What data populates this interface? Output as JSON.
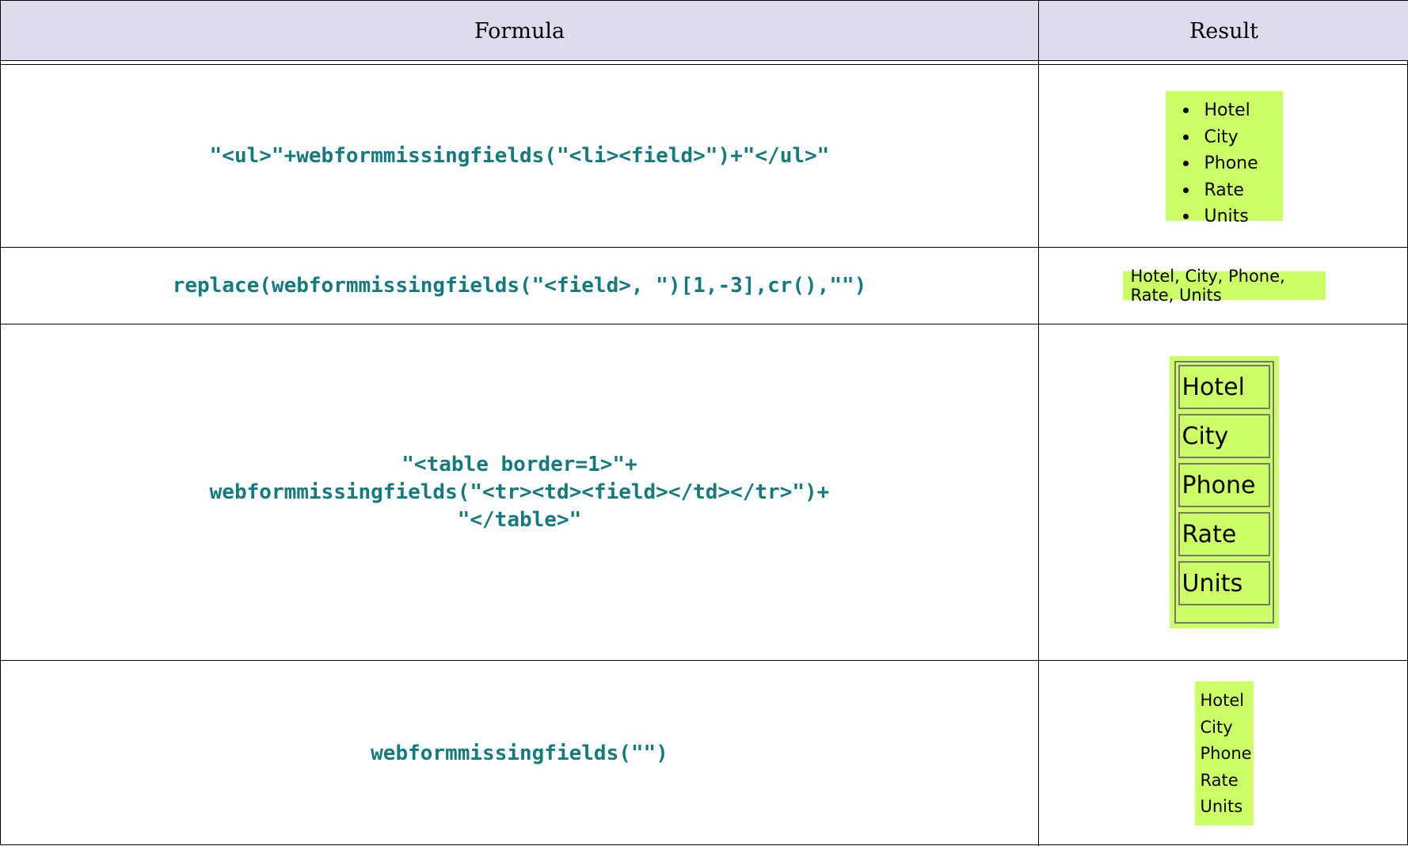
{
  "header": {
    "formula_label": "Formula",
    "result_label": "Result"
  },
  "rows": [
    {
      "formula": "\"<ul>\"+webformmissingfields(\"<li><field>\")+\"</ul>\"",
      "result": {
        "kind": "bulleted-list",
        "items": [
          "Hotel",
          "City",
          "Phone",
          "Rate",
          "Units"
        ]
      }
    },
    {
      "formula": "replace(webformmissingfields(\"<field>, \")[1,-3],cr(),\"\")",
      "result": {
        "kind": "comma-list",
        "text": "Hotel, City, Phone, Rate, Units"
      }
    },
    {
      "formula_lines": [
        "\"<table border=1>\"+",
        "webformmissingfields(\"<tr><td><field></td></tr>\")+",
        "\"</table>\""
      ],
      "result": {
        "kind": "bordered-table",
        "items": [
          "Hotel",
          "City",
          "Phone",
          "Rate",
          "Units"
        ]
      }
    },
    {
      "formula": "webformmissingfields(\"\")",
      "result": {
        "kind": "plain-list",
        "items": [
          "Hotel",
          "City",
          "Phone",
          "Rate",
          "Units"
        ]
      }
    }
  ],
  "colors": {
    "header_bg": "#dcdcec",
    "formula_text": "#157a7e",
    "result_bg": "#ccff66"
  }
}
